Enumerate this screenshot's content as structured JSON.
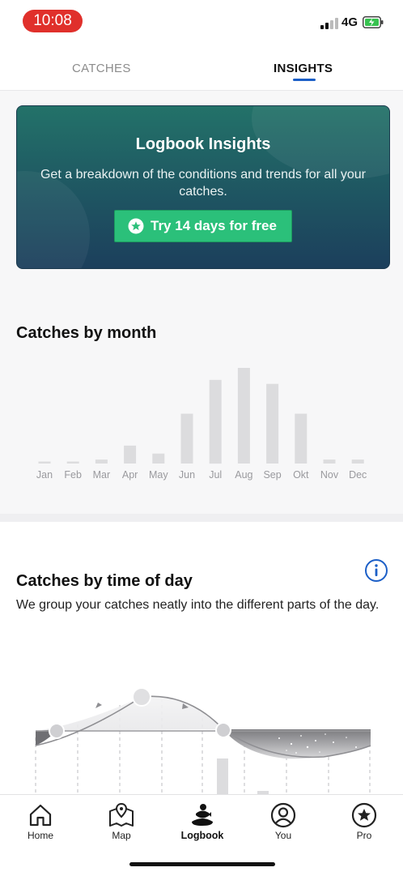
{
  "status_bar": {
    "time": "10:08",
    "network": "4G",
    "time_pill_color": "#e0302b"
  },
  "tabs": [
    {
      "label": "CATCHES",
      "active": false
    },
    {
      "label": "INSIGHTS",
      "active": true
    }
  ],
  "promo": {
    "title": "Logbook Insights",
    "text": "Get a breakdown of the conditions and trends for all your catches.",
    "button_label": "Try 14 days for free",
    "button_color": "#2bc07a"
  },
  "catches_by_month": {
    "title": "Catches by month",
    "chart_data": {
      "type": "bar",
      "categories": [
        "Jan",
        "Feb",
        "Mar",
        "Apr",
        "May",
        "Jun",
        "Jul",
        "Aug",
        "Sep",
        "Okt",
        "Nov",
        "Dec"
      ],
      "values": [
        1,
        1,
        2,
        9,
        5,
        25,
        42,
        48,
        40,
        25,
        2,
        2
      ],
      "bar_color": "#dcdcde"
    }
  },
  "catches_by_time_of_day": {
    "title": "Catches by time of day",
    "description": "We group your catches neatly into the different parts of the day.",
    "info_icon": "info-circle-icon"
  },
  "bottom_nav": [
    {
      "label": "Home",
      "icon": "home-icon",
      "active": false
    },
    {
      "label": "Map",
      "icon": "map-pin-icon",
      "active": false
    },
    {
      "label": "Logbook",
      "icon": "fish-catch-icon",
      "active": true
    },
    {
      "label": "You",
      "icon": "user-icon",
      "active": false
    },
    {
      "label": "Pro",
      "icon": "star-badge-icon",
      "active": false
    }
  ]
}
